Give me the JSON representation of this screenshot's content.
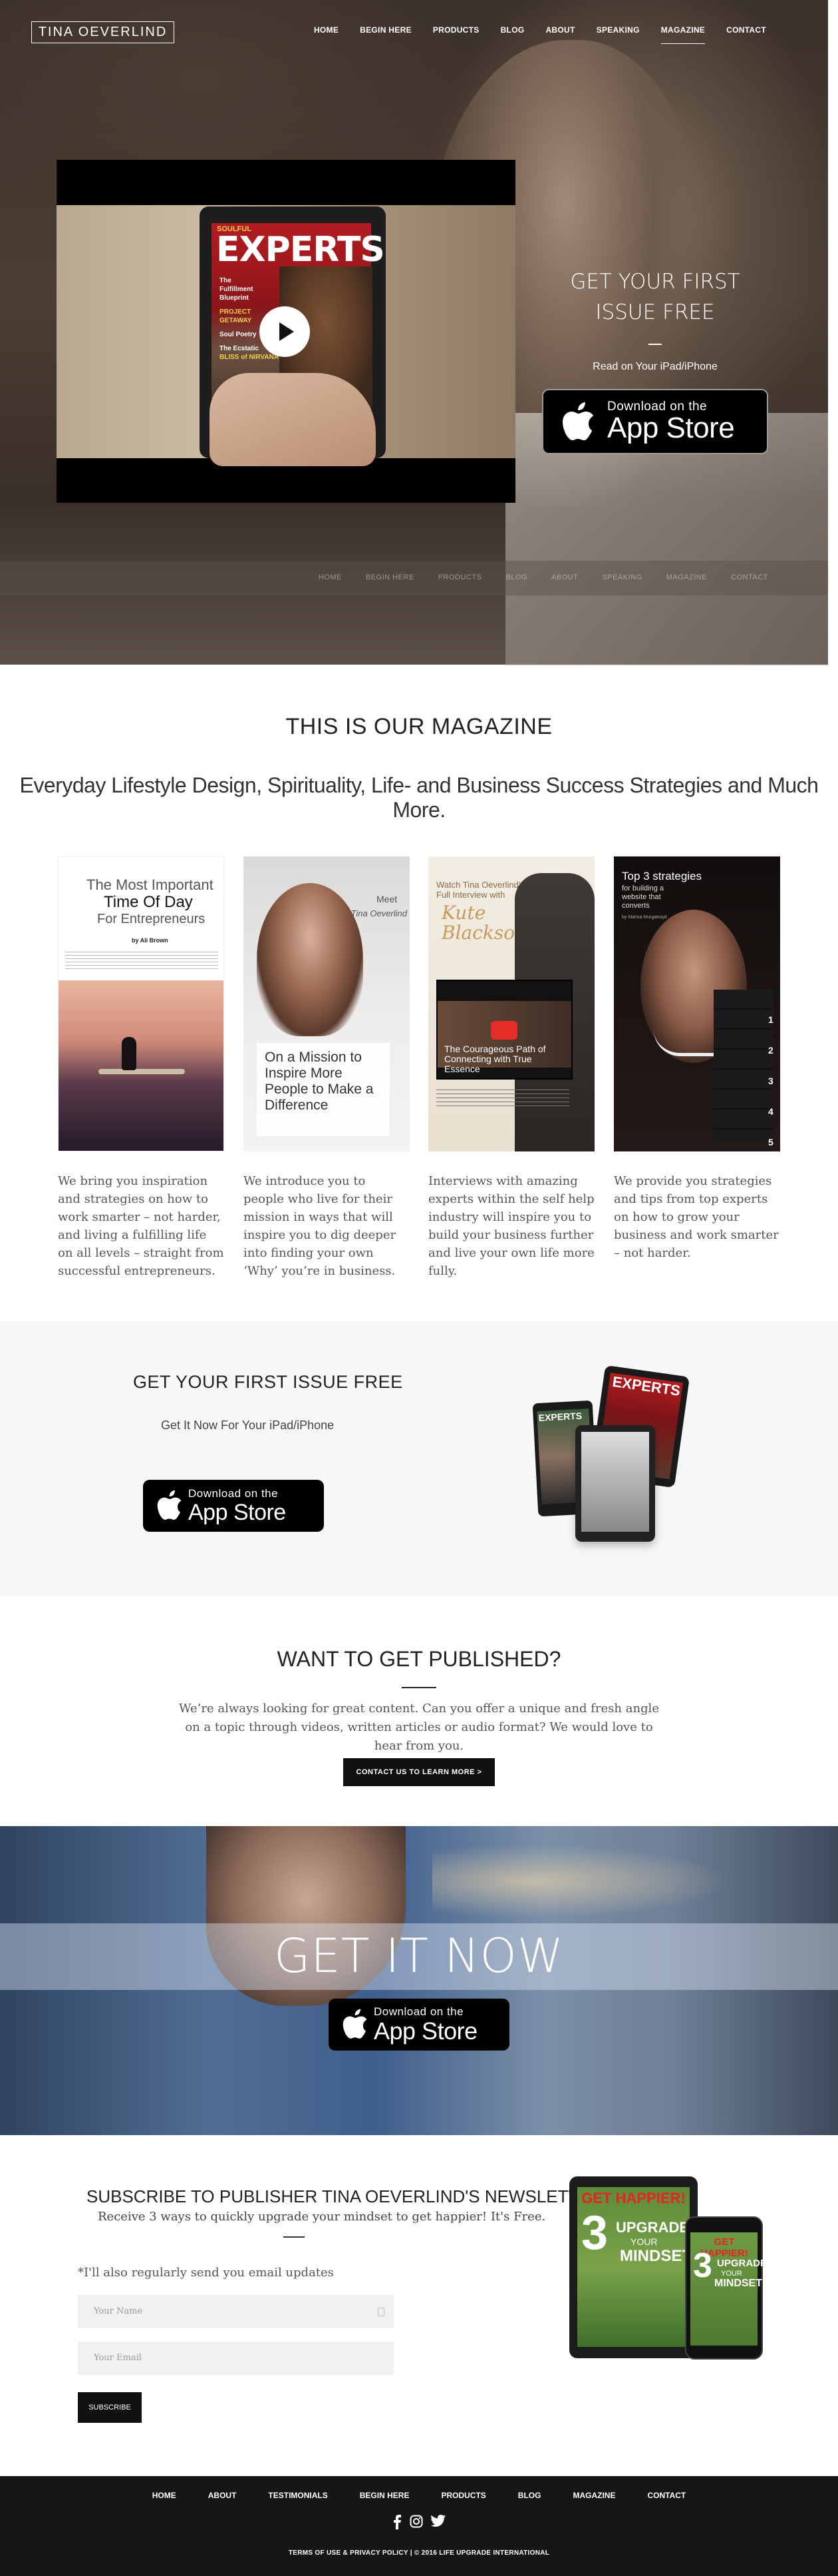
{
  "header": {
    "logo": "TINA OEVERLIND",
    "nav": [
      "HOME",
      "BEGIN HERE",
      "PRODUCTS",
      "BLOG",
      "ABOUT",
      "SPEAKING",
      "MAGAZINE",
      "CONTACT"
    ],
    "active": "MAGAZINE"
  },
  "hero": {
    "video": {
      "mag_brand": "SOULFUL",
      "mag_title": "EXPERTS",
      "cover_lines": [
        "The",
        "Fulfillment",
        "Blueprint",
        "",
        "PROJECT",
        "GETAWAY",
        "",
        "Soul Poetry",
        "",
        "The Ecstatic",
        "BLISS of NIRVANA"
      ],
      "play_icon": "play-icon"
    },
    "cta_title": "GET YOUR FIRST ISSUE FREE",
    "cta_sub": "Read on Your iPad/iPhone",
    "appstore": {
      "line1": "Download on the",
      "line2": "App Store"
    }
  },
  "magazine": {
    "heading": "THIS IS OUR MAGAZINE",
    "tagline": "Everyday Lifestyle Design, Spirituality, Life- and Business Success Strategies and Much More.",
    "covers": [
      {
        "title1": "The Most Important",
        "title2": "Time Of Day",
        "title3": "For Entrepreneurs",
        "byline": "by Ali Brown"
      },
      {
        "title1": "Meet",
        "title2": "Tina Oeverlind",
        "title3": "On a Mission to Inspire More People to Make a Difference",
        "byline": ""
      },
      {
        "title1": "Watch Tina Oeverlind's Full Interview with",
        "title2": "Kute Blackson",
        "title3": "The Courageous Path of Connecting with True Essence",
        "byline": ""
      },
      {
        "title1": "Top 3 strategies",
        "title2": "for building a website that converts",
        "title3": "",
        "byline": "by Marisa Murgatroyd"
      }
    ],
    "descriptions": [
      "We bring you inspiration and strategies on how to work smarter – not harder, and living a fulfilling life on all levels – straight from successful entrepreneurs.",
      "We introduce you to people who live for their mission in ways that will inspire you to dig deeper into finding your own ‘Why’ you’re in business.",
      "Interviews with amazing experts within the self help industry will inspire you to build your business further and live your own life more fully.",
      "We provide you strategies and tips from top experts on how to grow your business and work smarter – not harder."
    ]
  },
  "first_issue": {
    "title": "GET YOUR FIRST ISSUE FREE",
    "sub": "Get It Now For Your iPad/iPhone",
    "appstore": {
      "line1": "Download on the",
      "line2": "App Store"
    },
    "devices_mag": "EXPERTS"
  },
  "published": {
    "title": "WANT TO GET PUBLISHED?",
    "text": "We’re always looking for great content. Can you offer a unique and fresh angle on a topic through videos, written articles or audio format? We would love to hear from you.",
    "button": "CONTACT US TO LEARN MORE  >"
  },
  "getit": {
    "title": "GET IT NOW",
    "appstore": {
      "line1": "Download on the",
      "line2": "App Store"
    }
  },
  "newsletter": {
    "title": "SUBSCRIBE TO PUBLISHER TINA OEVERLIND'S NEWSLETTER",
    "sub": "Receive 3 ways to quickly upgrade your mindset to get happier! It's Free.",
    "note": "*I'll also regularly send you email updates",
    "name_placeholder": "Your Name",
    "email_placeholder": "Your Email",
    "button": "SUBSCRIBE",
    "promo": {
      "line1": "GET HAPPIER!",
      "num": "3",
      "line2": "UPGRADE",
      "line3": "YOUR",
      "line4": "MINDSET"
    }
  },
  "footer": {
    "nav": [
      "HOME",
      "ABOUT",
      "TESTIMONIALS",
      "BEGIN HERE",
      "PRODUCTS",
      "BLOG",
      "MAGAZINE",
      "CONTACT"
    ],
    "social": [
      "facebook-icon",
      "instagram-icon",
      "twitter-icon"
    ],
    "copyright": "TERMS OF USE & PRIVACY POLICY | © 2016 LIFE UPGRADE INTERNATIONAL"
  },
  "colors": {
    "dark": "#111111",
    "footer": "#161616",
    "band": "#f7f7f7",
    "magazine_red": "#c1272d"
  }
}
